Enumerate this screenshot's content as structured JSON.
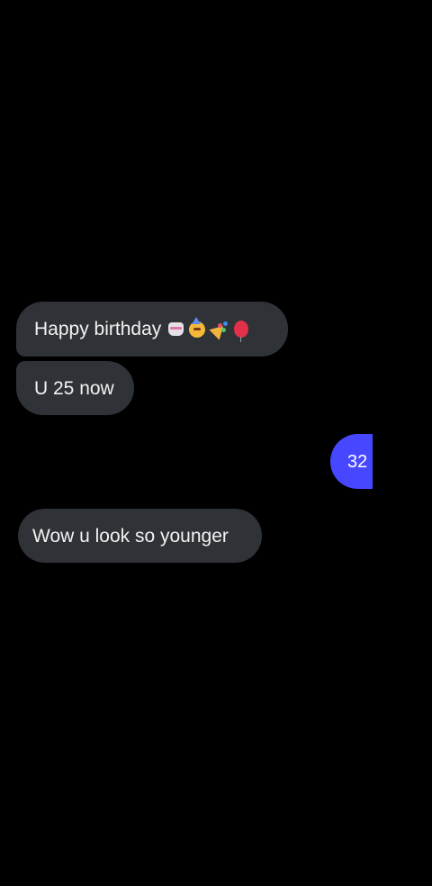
{
  "messages": [
    {
      "direction": "incoming",
      "text": "Happy birthday",
      "emojis": [
        "cake-icon",
        "party-face-icon",
        "party-popper-icon",
        "balloon-icon"
      ]
    },
    {
      "direction": "incoming",
      "text": "U 25 now"
    },
    {
      "direction": "outgoing",
      "text": "32"
    },
    {
      "direction": "incoming",
      "text": "Wow u look so younger"
    }
  ],
  "colors": {
    "background": "#000000",
    "incoming_bubble": "#2f3236",
    "outgoing_bubble": "#4747ff",
    "text": "#f2f2f2"
  }
}
